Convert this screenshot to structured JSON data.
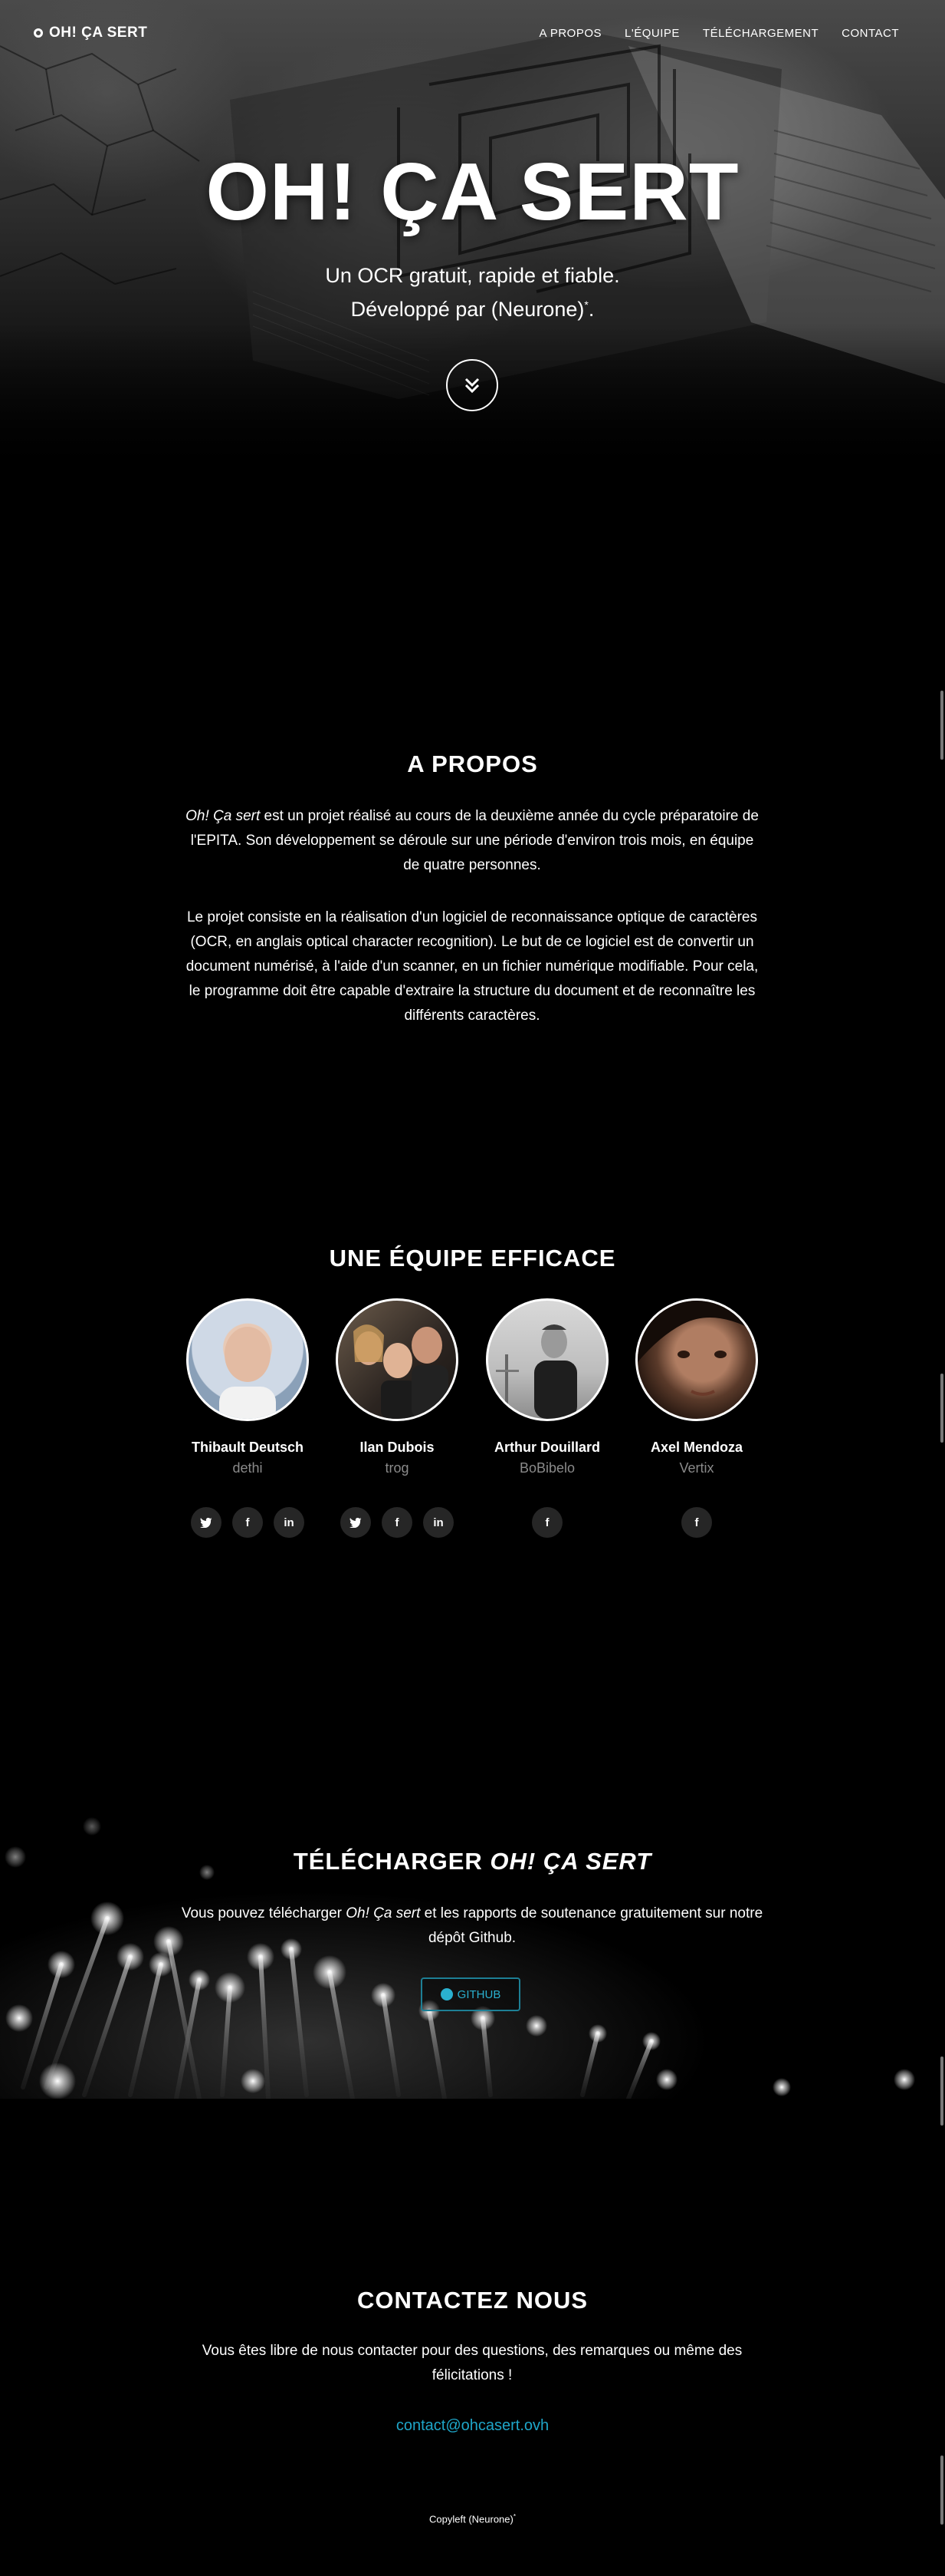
{
  "nav": {
    "brand": "OH! ÇA SERT",
    "links": [
      "A PROPOS",
      "L'ÉQUIPE",
      "TÉLÉCHARGEMENT",
      "CONTACT"
    ]
  },
  "hero": {
    "title": "OH! ÇA SERT",
    "line1": "Un OCR gratuit, rapide et fiable.",
    "line2": "Développé par (Neurone)",
    "line2_sup": "*"
  },
  "about": {
    "title": "A PROPOS",
    "p1_em": "Oh! Ça sert",
    "p1_rest": " est un projet réalisé au cours de la deuxième année du cycle préparatoire de l'EPITA. Son développement se déroule sur une période d'environ trois mois, en équipe de quatre personnes.",
    "p2": "Le projet consiste en la réalisation d'un logiciel de reconnaissance optique de caractères (OCR, en anglais optical character recognition). Le but de ce logiciel est de convertir un document numérisé, à l'aide d'un scanner, en un fichier numérique modifiable. Pour cela, le programme doit être capable d'extraire la structure du document et de reconnaître les différents caractères."
  },
  "team": {
    "title": "UNE ÉQUIPE EFFICACE",
    "members": [
      {
        "name": "Thibault Deutsch",
        "nick": "dethi",
        "socials": [
          "twitter-icon",
          "facebook-icon",
          "linkedin-icon"
        ]
      },
      {
        "name": "Ilan Dubois",
        "nick": "trog",
        "socials": [
          "twitter-icon",
          "facebook-icon",
          "linkedin-icon"
        ]
      },
      {
        "name": "Arthur Douillard",
        "nick": "BoBibelo",
        "socials": [
          "facebook-icon"
        ]
      },
      {
        "name": "Axel Mendoza",
        "nick": "Vertix",
        "socials": [
          "facebook-icon"
        ]
      }
    ]
  },
  "download": {
    "title_plain": "TÉLÉCHARGER ",
    "title_em": "OH! ÇA SERT",
    "text_pre": "Vous pouvez télécharger ",
    "text_em": "Oh! Ça sert",
    "text_post": " et les rapports de soutenance gratuitement sur notre dépôt Github.",
    "button": "GITHUB"
  },
  "contact": {
    "title": "CONTACTEZ NOUS",
    "text": "Vous êtes libre de nous contacter pour des questions, des remarques ou même des félicitations !",
    "email": "contact@ohcasert.ovh"
  },
  "footer": {
    "text": "Copyleft (Neurone)",
    "sup": "*"
  },
  "colors": {
    "accent": "#1fa6c9",
    "background": "#000000",
    "social_bg": "#262626",
    "muted": "#8a8a8a"
  }
}
